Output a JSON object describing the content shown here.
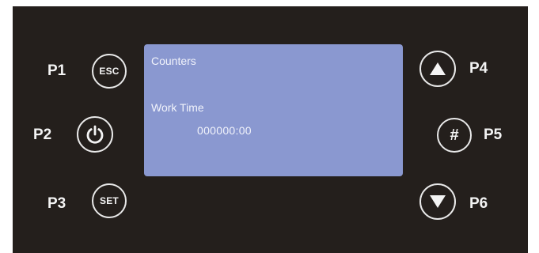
{
  "display": {
    "title": "Counters",
    "label": "Work Time",
    "value": "000000:00"
  },
  "buttons": {
    "p1": {
      "label": "P1",
      "text": "ESC"
    },
    "p2": {
      "label": "P2",
      "icon": "power-icon"
    },
    "p3": {
      "label": "P3",
      "text": "SET"
    },
    "p4": {
      "label": "P4",
      "icon": "arrow-up-icon"
    },
    "p5": {
      "label": "P5",
      "text": "#"
    },
    "p6": {
      "label": "P6",
      "icon": "arrow-down-icon"
    }
  },
  "colors": {
    "panel": "#241f1c",
    "lcd": "#8a98d0",
    "lcd_text": "#f1f3fb",
    "button_ring": "#e9e9e9"
  }
}
